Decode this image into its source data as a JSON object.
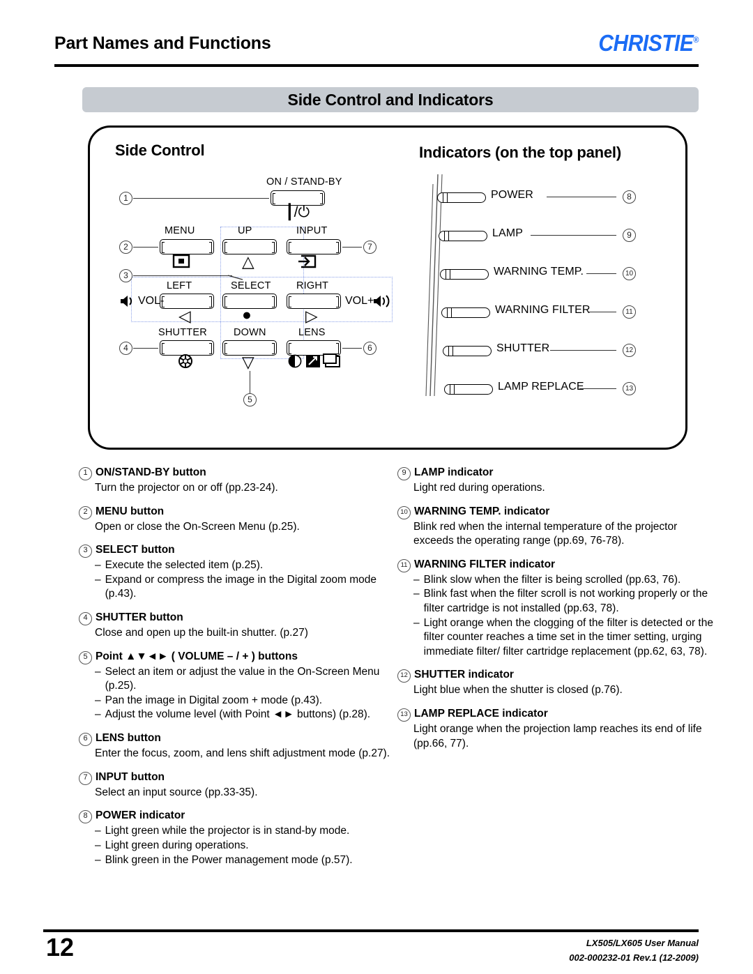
{
  "header": {
    "title": "Part Names and Functions",
    "logo": "CHRISTIE",
    "logo_reg": "®"
  },
  "section": {
    "band_title": "Side Control and Indicators"
  },
  "figure": {
    "left_heading": "Side Control",
    "right_heading": "Indicators (on the top panel)",
    "side_control": {
      "buttons": [
        {
          "label": "ON / STAND-BY",
          "icon": "power-symbol",
          "callout": "1"
        },
        {
          "label": "MENU",
          "icon": "menu-square-icon",
          "callout": "2"
        },
        {
          "label": "UP",
          "icon": "triangle-up-icon",
          "callout": ""
        },
        {
          "label": "INPUT",
          "icon": "input-arrow-icon",
          "callout": "7"
        },
        {
          "label": "LEFT",
          "icon": "triangle-left-icon",
          "side_label": "VOL-",
          "side_icon": "speaker-low-icon",
          "callout": ""
        },
        {
          "label": "SELECT",
          "icon": "filled-circle-icon",
          "callout": "3"
        },
        {
          "label": "RIGHT",
          "icon": "triangle-right-icon",
          "side_label": "VOL+",
          "side_icon": "speaker-high-icon",
          "callout": ""
        },
        {
          "label": "SHUTTER",
          "icon": "shutter-iris-icon",
          "callout": "4"
        },
        {
          "label": "DOWN",
          "icon": "triangle-down-icon",
          "callout": "5"
        },
        {
          "label": "LENS",
          "icon": "lens-focus-zoom-shift-icons",
          "callout": "6"
        }
      ]
    },
    "indicators": [
      {
        "label": "POWER",
        "callout": "8"
      },
      {
        "label": "LAMP",
        "callout": "9"
      },
      {
        "label": "WARNING TEMP.",
        "callout": "10"
      },
      {
        "label": "WARNING FILTER",
        "callout": "11"
      },
      {
        "label": "SHUTTER",
        "callout": "12"
      },
      {
        "label": "LAMP REPLACE",
        "callout": "13"
      }
    ]
  },
  "left_column": [
    {
      "num": "1",
      "title": "ON/STAND-BY button",
      "lines": [
        "Turn the projector on or off (pp.23-24)."
      ],
      "dashes": []
    },
    {
      "num": "2",
      "title": "MENU button",
      "lines": [
        "Open or close the On-Screen Menu (p.25)."
      ],
      "dashes": []
    },
    {
      "num": "3",
      "title": "SELECT button",
      "lines": [],
      "dashes": [
        "Execute the selected item (p.25).",
        "Expand or compress the image in the Digital zoom mode (p.43)."
      ]
    },
    {
      "num": "4",
      "title": "SHUTTER button",
      "lines": [
        "Close and open up the built-in shutter. (p.27)"
      ],
      "dashes": []
    },
    {
      "num": "5",
      "title": "Point ▲▼◄► ( VOLUME – / + ) buttons",
      "lines": [],
      "dashes": [
        "Select an item or adjust the value in the On-Screen Menu (p.25).",
        "Pan the image in Digital zoom + mode (p.43).",
        "Adjust the volume level (with Point ◄► buttons) (p.28)."
      ]
    },
    {
      "num": "6",
      "title": "LENS button",
      "lines": [
        "Enter the focus, zoom, and lens shift adjustment mode (p.27)."
      ],
      "dashes": []
    },
    {
      "num": "7",
      "title": "INPUT button",
      "lines": [
        "Select an input source (pp.33-35)."
      ],
      "dashes": []
    },
    {
      "num": "8",
      "title": "POWER indicator",
      "lines": [],
      "dashes": [
        "Light green while the projector is in stand-by mode.",
        "Light green during operations.",
        "Blink green in the Power management mode (p.57)."
      ]
    }
  ],
  "right_column": [
    {
      "num": "9",
      "title": "LAMP indicator",
      "lines": [
        "Light red during operations."
      ],
      "dashes": []
    },
    {
      "num": "10",
      "title": "WARNING TEMP. indicator",
      "lines": [
        "Blink red when the internal temperature of the projector exceeds the operating range (pp.69, 76-78)."
      ],
      "dashes": []
    },
    {
      "num": "11",
      "title": "WARNING FILTER indicator",
      "lines": [],
      "dashes": [
        "Blink slow when the filter is being scrolled (pp.63, 76).",
        "Blink fast when the filter scroll is not working properly or the filter cartridge is not installed (pp.63, 78).",
        "Light orange when the clogging of the filter is detected or the filter counter reaches a time set in the timer setting, urging immediate filter/ filter cartridge replacement (pp.62, 63, 78)."
      ]
    },
    {
      "num": "12",
      "title": "SHUTTER indicator",
      "lines": [
        "Light blue when the shutter is closed (p.76)."
      ],
      "dashes": []
    },
    {
      "num": "13",
      "title": "LAMP REPLACE indicator",
      "lines": [
        "Light orange when the projection lamp reaches its end of life (pp.66, 77)."
      ],
      "dashes": []
    }
  ],
  "footer": {
    "page_number": "12",
    "manual": "LX505/LX605 User Manual",
    "doc_id": "002-000232-01 Rev.1 (12-2009)"
  },
  "colors": {
    "band": "#c6cbd1",
    "logo": "#1b6cf5",
    "rule": "#000000"
  }
}
